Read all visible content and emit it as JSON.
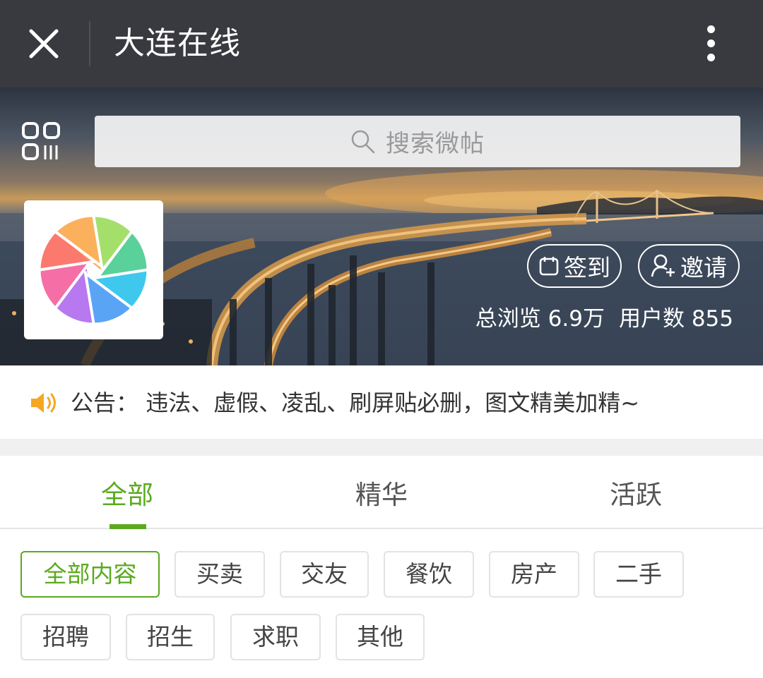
{
  "header": {
    "title": "大连在线"
  },
  "search": {
    "placeholder": "搜索微帖"
  },
  "actions": {
    "signin_label": "签到",
    "invite_label": "邀请"
  },
  "stats": {
    "views_label": "总浏览",
    "views_value": "6.9万",
    "users_label": "用户数",
    "users_value": "855"
  },
  "notice": {
    "label": "公告：",
    "text": "违法、虚假、凌乱、刷屏贴必删，图文精美加精~"
  },
  "tabs": [
    {
      "label": "全部",
      "active": true
    },
    {
      "label": "精华",
      "active": false
    },
    {
      "label": "活跃",
      "active": false
    }
  ],
  "categories": [
    {
      "label": "全部内容",
      "active": true
    },
    {
      "label": "买卖",
      "active": false
    },
    {
      "label": "交友",
      "active": false
    },
    {
      "label": "餐饮",
      "active": false
    },
    {
      "label": "房产",
      "active": false
    },
    {
      "label": "二手",
      "active": false
    },
    {
      "label": "招聘",
      "active": false
    },
    {
      "label": "招生",
      "active": false
    },
    {
      "label": "求职",
      "active": false
    },
    {
      "label": "其他",
      "active": false
    }
  ],
  "colors": {
    "topbar": "#393a3f",
    "accent_green": "#5aaa1e",
    "notice_icon": "#f5a623"
  },
  "icons": {
    "close": "close-icon",
    "more": "more-vertical-icon",
    "qr": "qr-code-icon",
    "search": "search-icon",
    "signin": "calendar-icon",
    "invite": "add-user-icon",
    "notice": "speaker-icon",
    "logo": "aperture-logo"
  }
}
